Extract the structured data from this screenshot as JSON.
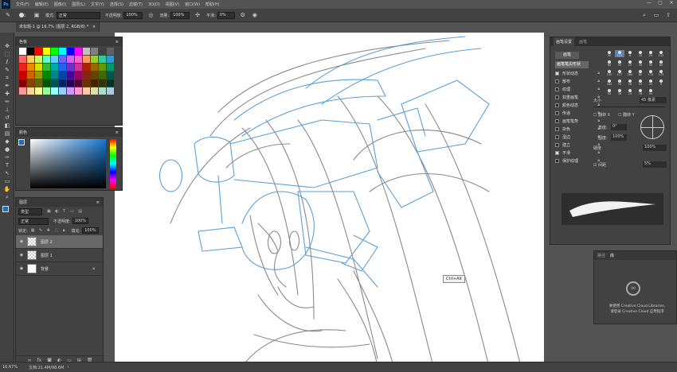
{
  "app": {
    "logo": "Ps"
  },
  "menu": [
    "文件(F)",
    "编辑(E)",
    "图像(I)",
    "图层(L)",
    "文字(Y)",
    "选择(S)",
    "滤镜(T)",
    "3D(D)",
    "视图(V)",
    "窗口(W)",
    "帮助(H)"
  ],
  "window_controls": {
    "minimize": "—",
    "maximize": "▢",
    "close": "✕"
  },
  "options": {
    "brush_size": "1",
    "mode_label": "模式:",
    "mode_value": "正常",
    "opacity_label": "不透明度:",
    "opacity_value": "100%",
    "flow_label": "流量:",
    "flow_value": "100%",
    "smooth_label": "平滑:",
    "smooth_value": "0%"
  },
  "doc_tab": {
    "title": "未标题-1 @ 16.7% (图层 2, RGB/8) *",
    "close": "×"
  },
  "tool_icons": [
    "move-icon",
    "marquee-icon",
    "lasso-icon",
    "quick-select-icon",
    "crop-icon",
    "eyedropper-icon",
    "healing-icon",
    "brush-icon",
    "stamp-icon",
    "history-brush-icon",
    "eraser-icon",
    "gradient-icon",
    "blur-icon",
    "dodge-icon",
    "pen-icon",
    "type-icon",
    "path-select-icon",
    "shape-icon",
    "hand-icon",
    "zoom-icon"
  ],
  "tool_glyphs": [
    "✥",
    "⬚",
    "ℓ",
    "✎",
    "⌗",
    "✒",
    "✚",
    "✏",
    "⊥",
    "↺",
    "◧",
    "▤",
    "◆",
    "●",
    "✑",
    "T",
    "↖",
    "▭",
    "✋",
    "⌕",
    "⋯"
  ],
  "swatches_panel": {
    "title": "色板"
  },
  "swatch_colors": [
    "#ffffff",
    "#000000",
    "#ff0000",
    "#ffff00",
    "#00ff00",
    "#00ffff",
    "#0000ff",
    "#ff00ff",
    "#c0c0c0",
    "#808080",
    "#404040",
    "#606060",
    "#ff6666",
    "#ffcc66",
    "#ccff66",
    "#66ffcc",
    "#66ccff",
    "#6666ff",
    "#cc66ff",
    "#ff66cc",
    "#ff9966",
    "#99cc33",
    "#33cc99",
    "#3399cc",
    "#ee2222",
    "#ee8800",
    "#dddd00",
    "#33bb33",
    "#00aaaa",
    "#2266ee",
    "#6633cc",
    "#cc3399",
    "#aa2200",
    "#996600",
    "#669900",
    "#009966",
    "#cc0000",
    "#cc6600",
    "#999900",
    "#008800",
    "#008888",
    "#0044aa",
    "#440099",
    "#990066",
    "#882211",
    "#664400",
    "#446600",
    "#005544",
    "#880000",
    "#884400",
    "#666600",
    "#005500",
    "#005555",
    "#002266",
    "#220055",
    "#550033",
    "#663300",
    "#442200",
    "#333300",
    "#003322",
    "#ff9999",
    "#ffd699",
    "#ffff99",
    "#99ff99",
    "#99ffff",
    "#99ccff",
    "#cc99ff",
    "#ff99cc",
    "#ffccaa",
    "#ddddaa",
    "#aaddcc",
    "#aaccdd"
  ],
  "color_panel": {
    "title": "颜色"
  },
  "layers_panel": {
    "title": "图层",
    "kind_label": "类型",
    "blend_mode": "正常",
    "opacity_label": "不透明度:",
    "opacity_value": "100%",
    "lock_label": "锁定:",
    "fill_label": "填充:",
    "fill_value": "100%",
    "layers": [
      {
        "name": "图层 2",
        "selected": true
      },
      {
        "name": "图层 1",
        "selected": false
      },
      {
        "name": "背景",
        "selected": false,
        "locked": true
      }
    ]
  },
  "brush_panel": {
    "tab1": "画笔设置",
    "tab2": "画笔",
    "preset_button": "画笔",
    "tip_button": "画笔笔尖形状",
    "sizes": [
      "30",
      "123",
      "8",
      "10",
      "25",
      "112",
      "60",
      "50",
      "25",
      "30",
      "50",
      "60",
      "100",
      "127",
      "284",
      "80",
      "174",
      "175",
      "306",
      "50",
      "16",
      "25",
      "20",
      "9",
      "55",
      "36",
      "24",
      "16",
      "94"
    ],
    "options": [
      {
        "label": "形状动态",
        "checked": true
      },
      {
        "label": "散布",
        "checked": false
      },
      {
        "label": "纹理",
        "checked": false
      },
      {
        "label": "双重画笔",
        "checked": false
      },
      {
        "label": "颜色动态",
        "checked": false
      },
      {
        "label": "传递",
        "checked": false
      },
      {
        "label": "画笔笔势",
        "checked": false
      },
      {
        "label": "杂色",
        "checked": false
      },
      {
        "label": "湿边",
        "checked": false
      },
      {
        "label": "建立",
        "checked": false
      },
      {
        "label": "平滑",
        "checked": true
      },
      {
        "label": "保护纹理",
        "checked": false
      }
    ],
    "size_label": "大小",
    "size_value": "45 像素",
    "flip_x": "翻转 X",
    "flip_y": "翻转 Y",
    "angle_label": "角度:",
    "angle_value": "0°",
    "roundness_label": "圆度:",
    "roundness_value": "100%",
    "hardness_label": "硬度",
    "hardness_value": "100%",
    "spacing_label": "间距",
    "spacing_value": "5%"
  },
  "library_panel": {
    "tab1": "路径",
    "tab2": "库",
    "message_line1": "要使用 Creative Cloud Libraries,",
    "message_line2": "请登录 Creative Cloud 应用程序"
  },
  "tooltip": "Ctrl+Alt",
  "status": {
    "zoom": "16.67%",
    "doc": "文档:21.4M/98.6M"
  }
}
